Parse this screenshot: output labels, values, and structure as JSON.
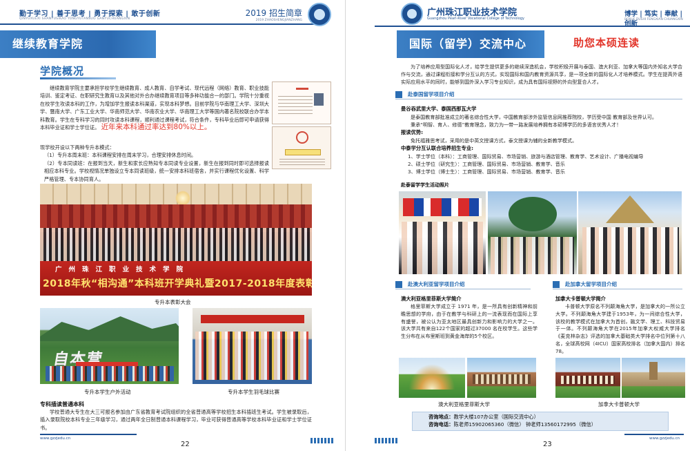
{
  "left": {
    "header": {
      "mottos": "勤于学习 | 善于思考 | 勇于探索 | 敢于创新",
      "mottos_pinyin": "QINYUXUEXI SHANYUSIKAO YONGYUTANSUO GANYUCHUANGXIN",
      "guide_title": "2019 招生简章",
      "guide_pinyin": "2019 ZHAOSHENGJIANZHANG",
      "logo": "school-emblem"
    },
    "banner": "继续教育学院",
    "section_title": "学院概况",
    "intro": "继续教育学院主要承担学校学生继续教育、成人教育、自学考试、现代远程（网络）教育、职业技能培训、鉴定考证、在职研究生教育以及其他对外合办继续教育项目等多种功能合一的部门。学院十分重视在校学生攻读本科的工作，为增加学生报读本科渠道，实现本科梦想。目前学院与华南理工大学、深圳大学、暨南大学、广东工业大学、华南师范大学、华南农业大学、华南理工大学等国内著名院校联合办学本科教育。学生在专科学习的同时攻读本科课程，顺利通过课程考试，符合条件，专科毕业后即可申请获得本科毕业证和学士学位证。",
    "intro_highlight": "近年来本科通过率达到80%以上。",
    "modes_title": "现学校开设以下两种专升本模式：",
    "mode1": "（1）专升本周末班：本科课程安排在周末学习，合理安排休息时间。",
    "mode2": "（2）专本同读班：在报到当天，新生和家长应熟知专本同读专业设置，新生在报到同时即可选择报读相应本科专业。学校视情况单独设立专本同读班级，统一安排本科班宿舍，并实行课程优化设置、科学严格管理、专本协同育人。",
    "photo_banner_line1": "广州珠江职业技术学院",
    "photo_banner_line2": "2018年秋“相沟通”本科班开学典礼暨2017-2018年度表彰大会",
    "caption_main": "专升本表彰大会",
    "outdoor_letters": "自本营",
    "caption_outdoor": "专升本学生户外活动",
    "caption_badminton": "专升本学生羽毛球比赛",
    "insert_title": "专科插读普通本科",
    "insert_text": "学校普通大专生在大三可报名参加由广东省教育考试院组织的全省普通高等学校招生本科插班生考试。学生被录取后，插入录取院校本科专业三年级学习，通过两年全日制普通本科课程学习，毕业可获得普通高等学校本科毕业证和学士学位证书。",
    "footer_url": "www.gzzjedu.cn",
    "page_number": "22"
  },
  "right": {
    "header": {
      "logo": "school-emblem",
      "school_name": "广州珠江职业技术学院",
      "school_name_en": "Guangzhou Pearl-River Vocational College of Technology",
      "mottos": "博学 | 笃实 | 奉献 | 创新",
      "mottos_pinyin": "BOXUE DUSHI FENGXIAN CHUANGXIN"
    },
    "banner": "国际（留学）交流中心",
    "slogan": "助您本硕连读",
    "intro": "为了培养应用型国际化人才，给学生提供更多的继续深造机会，学校积极开展与泰国、澳大利亚、加拿大等国内外知名大学合作与交流，通过课程衔接和学分互认的方式，实现国际和国内教育资源共享，是一项全新的国际化人才培养模式。学生在提高外语实际应用水平的同时，能够到国外深入学习专业知识，成为具有国际视野的外向型复合人才。",
    "thai_title": "赴泰国留学项目介绍",
    "thai_univ": "曼谷吞武里大学、泰国西那瓦大学",
    "thai_univ_text": "是泰国教育部批准成立的著名综合性大学，中国教育部涉外监管信息网推荐院校，学历受中国 教育部及世界认可。",
    "thai_philosophy": "秉承“明智、育人、修德”教育理念，致力为一带一路发展培养拥有本硕博学历的多语言优秀人才！",
    "exam_title": "报读优势:",
    "exam_text": "免托福雅思考试，采用的是中英文授课方式，泰文授课为辅的全新教学模式。",
    "program_title": "中泰学分互认联合培养招生专业:",
    "program1": "1、学士学位（本科）：工商管理、国际贸易、市场营销、旅游与酒店管理、教育学、艺术设计、广播电视编导",
    "program2": "2、硕士学位（研究生）：工商管理、国际贸易、市场营销、教育学、音乐",
    "program3": "3、博士学位（博士生）：工商管理、国际贸易、市场营销、教育学、音乐",
    "photos_title": "赴泰留学学生活动照片",
    "aus_title": "赴澳大利亚留学项目介绍",
    "aus_univ": "澳大利亚格里菲斯大学简介",
    "aus_text": "格里菲斯大学成立于 1971 年，是一所具有创新精神和前瞻思想的学府，由于在教学与科研上的一流表现而在国际上享有盛誉，被公认为亚太地区最具创新力和影响力的大学之一。该大学共有来自122个国家的超过37000 名在校学生。这些学生分布在从布里斯班到黄金海岸的5个校区。",
    "aus_caption": "澳大利亚格里菲斯大学",
    "can_title": "赴加拿大留学项目介绍",
    "can_univ": "加拿大卡普顿大学简介",
    "can_text": "卡普顿大学原名不列颠海角大学，是加拿大的一所公立大学。不列颠海角大学建于1953年，为一间综合性大学，该校的教学模式在加拿大为首创，融文学、理工、科技贸易于一体。不列颠海角大学在2015年加拿大权威大学排名《麦克林杂志》评选的加拿大基础类大学排名中位列第十八名，全球高校网（4ICU）国家高校排名（加拿大国内）排名78。",
    "can_caption": "加拿大卡普顿大学",
    "contact_addr_label": "咨询地点：",
    "contact_addr": "教学大楼107办公室（国际交流中心）",
    "contact_tel_label": "咨询电话：",
    "contact_tel": "陈老师15902065360（微信） 钟老师13560172995（微信）",
    "footer_url": "www.gzzjedu.cn",
    "page_number": "23"
  }
}
